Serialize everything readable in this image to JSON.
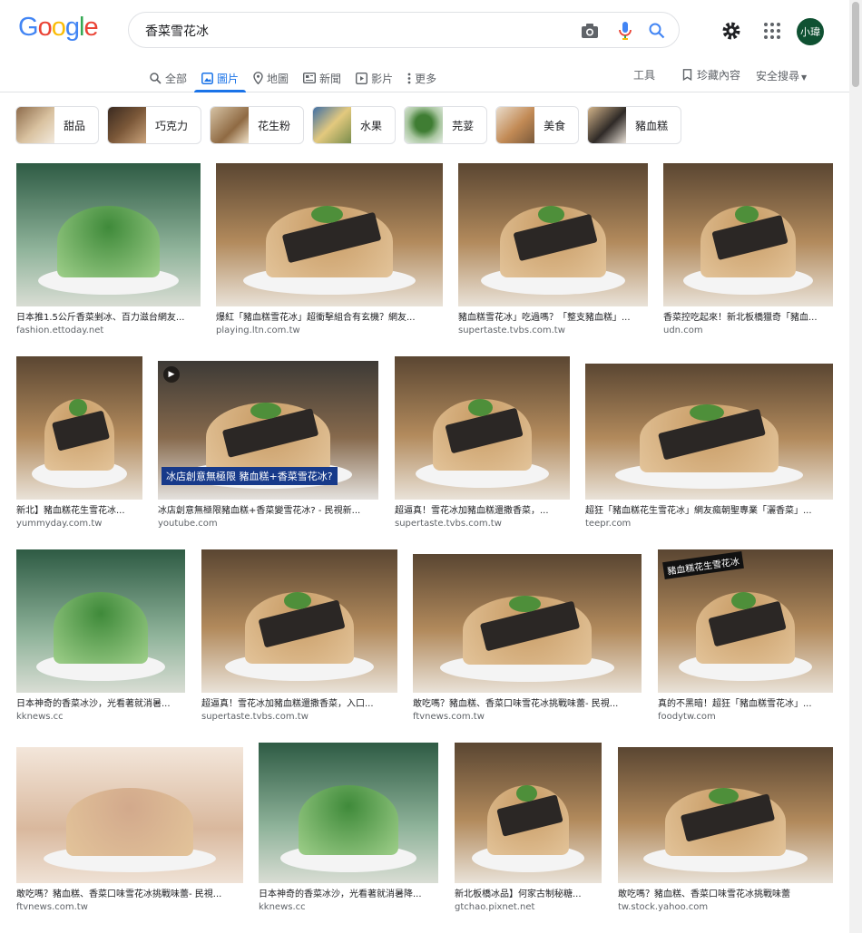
{
  "logo": {
    "letters": [
      "G",
      "o",
      "o",
      "g",
      "l",
      "e"
    ]
  },
  "search": {
    "query": "香菜雪花冰"
  },
  "avatar": {
    "initials": "小瑋"
  },
  "tabs": [
    {
      "label": "全部",
      "icon": "search-icon"
    },
    {
      "label": "圖片",
      "icon": "image-icon",
      "active": true
    },
    {
      "label": "地圖",
      "icon": "map-pin-icon"
    },
    {
      "label": "新聞",
      "icon": "newspaper-icon"
    },
    {
      "label": "影片",
      "icon": "play-icon"
    },
    {
      "label": "更多",
      "icon": "more-vert-icon"
    }
  ],
  "tools_label": "工具",
  "saved_label": "珍藏內容",
  "safe_search_label": "安全搜尋",
  "chips": [
    {
      "label": "甜品",
      "color": "#b7a28a"
    },
    {
      "label": "巧克力",
      "color": "#6b4a36"
    },
    {
      "label": "花生粉",
      "color": "#b08c5e"
    },
    {
      "label": "水果",
      "color": "#c9b07a"
    },
    {
      "label": "芫荽",
      "color": "#6f9a5a"
    },
    {
      "label": "美食",
      "color": "#c4a27a"
    },
    {
      "label": "豬血糕",
      "color": "#4c4441"
    }
  ],
  "results": [
    {
      "caption": "日本推1.5公斤香菜剉冰、百力滋台網友...",
      "source": "fashion.ettoday.net",
      "kind": "green"
    },
    {
      "caption": "爆紅「豬血糕雪花冰」超衝擊組合有玄機？網友...",
      "source": "playing.ltn.com.tw",
      "kind": "brown"
    },
    {
      "caption": "豬血糕雪花冰」吃過嗎？「整支豬血糕」...",
      "source": "supertaste.tvbs.com.tw",
      "kind": "brown"
    },
    {
      "caption": "香菜控吃起來！新北板橋獵奇「豬血...",
      "source": "udn.com",
      "kind": "brown"
    },
    {
      "caption": "新北】豬血糕花生雪花冰...",
      "source": "yummyday.com.tw",
      "kind": "brown"
    },
    {
      "caption": "冰店創意無極限豬血糕+香菜變雪花冰? - 民視新...",
      "source": "youtube.com",
      "kind": "video",
      "overlay": "冰店創意無極限 豬血糕+香菜雪花冰?"
    },
    {
      "caption": "超逼真！雪花冰加豬血糕還撒香菜，...",
      "source": "supertaste.tvbs.com.tw",
      "kind": "brown"
    },
    {
      "caption": "超狂「豬血糕花生雪花冰」網友瘋朝聖專業「灑香菜」...",
      "source": "teepr.com",
      "kind": "brown"
    },
    {
      "caption": "日本神奇的香菜冰沙，光看著就消暑...",
      "source": "kknews.cc",
      "kind": "green"
    },
    {
      "caption": "超逼真！雪花冰加豬血糕還撒香菜，入口...",
      "source": "supertaste.tvbs.com.tw",
      "kind": "brown"
    },
    {
      "caption": "敢吃嗎？豬血糕、香菜口味雪花冰挑戰味蕾- 民視...",
      "source": "ftvnews.com.tw",
      "kind": "brown"
    },
    {
      "caption": "真的不黑暗！超狂「豬血糕雪花冰」...",
      "source": "foodytw.com",
      "kind": "brown",
      "overlay": "豬血糕花生雪花冰"
    },
    {
      "caption": "敢吃嗎？豬血糕、香菜口味雪花冰挑戰味蕾- 民視...",
      "source": "ftvnews.com.tw",
      "kind": "pale"
    },
    {
      "caption": "日本神奇的香菜冰沙，光看著就消暑降...",
      "source": "kknews.cc",
      "kind": "green"
    },
    {
      "caption": "新北板橋冰品】何家古制秘糖...",
      "source": "gtchao.pixnet.net",
      "kind": "brown"
    },
    {
      "caption": "敢吃嗎？豬血糕、香菜口味雪花冰挑戰味蕾",
      "source": "tw.stock.yahoo.com",
      "kind": "brown"
    }
  ]
}
